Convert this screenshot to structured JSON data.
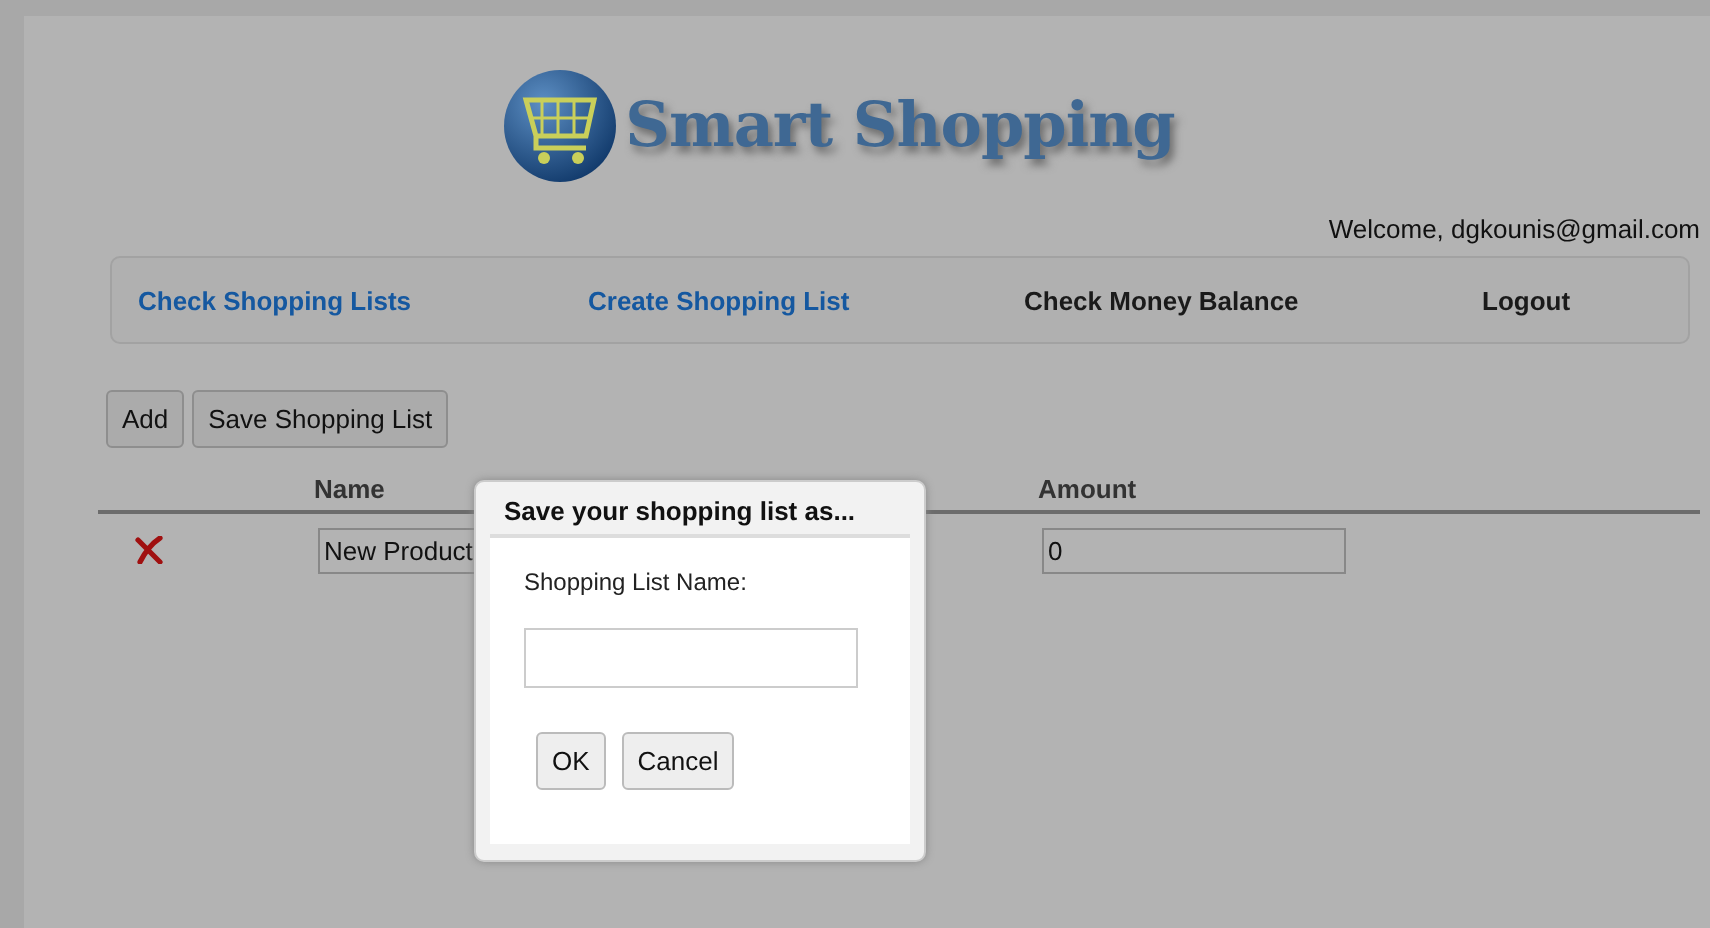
{
  "logo": {
    "text": "Smart Shopping"
  },
  "welcome": "Welcome, dgkounis@gmail.com",
  "nav": [
    {
      "label": "Check Shopping Lists",
      "kind": "link"
    },
    {
      "label": "Create Shopping List",
      "kind": "link"
    },
    {
      "label": "Check Money Balance",
      "kind": "plain"
    },
    {
      "label": "Logout",
      "kind": "plain"
    }
  ],
  "buttons": [
    "Add",
    "Save Shopping List"
  ],
  "table": {
    "columns": [
      "Name",
      "Amount"
    ],
    "rows": [
      {
        "name": "New Product",
        "amount": "0"
      }
    ]
  },
  "dialog": {
    "title": "Save your shopping list as...",
    "field_label": "Shopping List Name:",
    "buttons": [
      "OK",
      "Cancel"
    ]
  }
}
